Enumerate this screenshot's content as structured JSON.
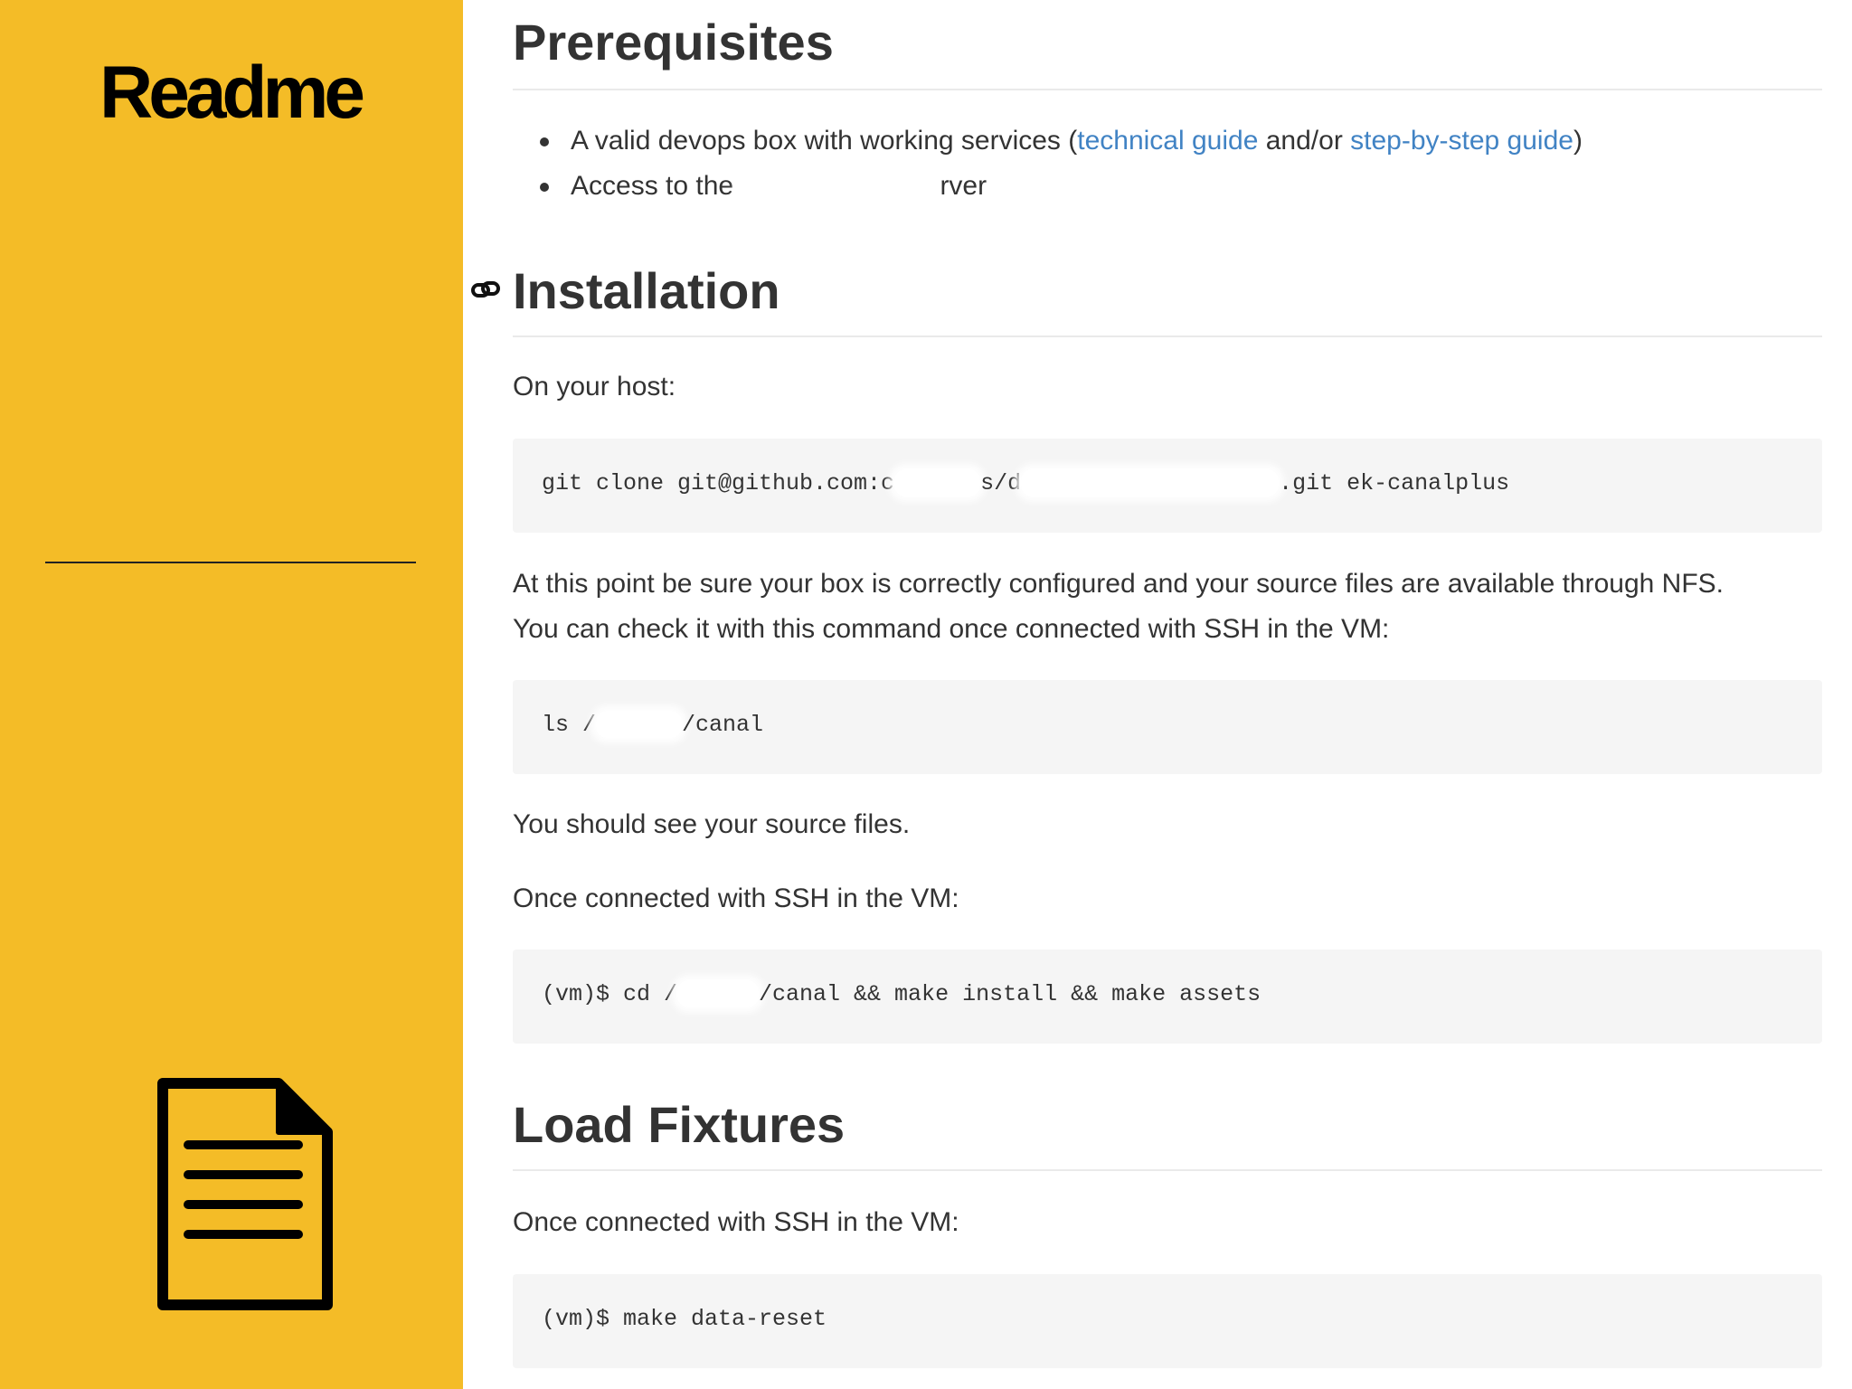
{
  "sidebar": {
    "title": "Readme",
    "icon": "document-icon"
  },
  "prerequisites": {
    "heading": "Prerequisites",
    "item1": {
      "before": "A valid devops box with working services (",
      "link1": "technical guide",
      "middle": " and/or ",
      "link2": "step-by-step guide",
      "after": ")"
    },
    "item2": {
      "before": "Access to the ",
      "after": "rver"
    }
  },
  "installation": {
    "heading": "Installation",
    "anchor_icon": "link-icon",
    "intro": "On your host:",
    "code1": {
      "part1": "git clone git@github.com:c",
      "part2": "s/d",
      "part3": ".git ek-canalplus"
    },
    "check_line1": "At this point be sure your box is correctly configured and your source files are available through NFS.",
    "check_line2": "You can check it with this command once connected with SSH in the VM:",
    "code2": {
      "part1": "ls /",
      "part2": "/canal"
    },
    "see_files": "You should see your source files.",
    "once_connected": "Once connected with SSH in the VM:",
    "code3": {
      "part1": "(vm)$ cd /",
      "part2": "/canal && make install && make assets"
    }
  },
  "fixtures": {
    "heading": "Load Fixtures",
    "once_connected": "Once connected with SSH in the VM:",
    "code": "(vm)$ make data-reset"
  }
}
